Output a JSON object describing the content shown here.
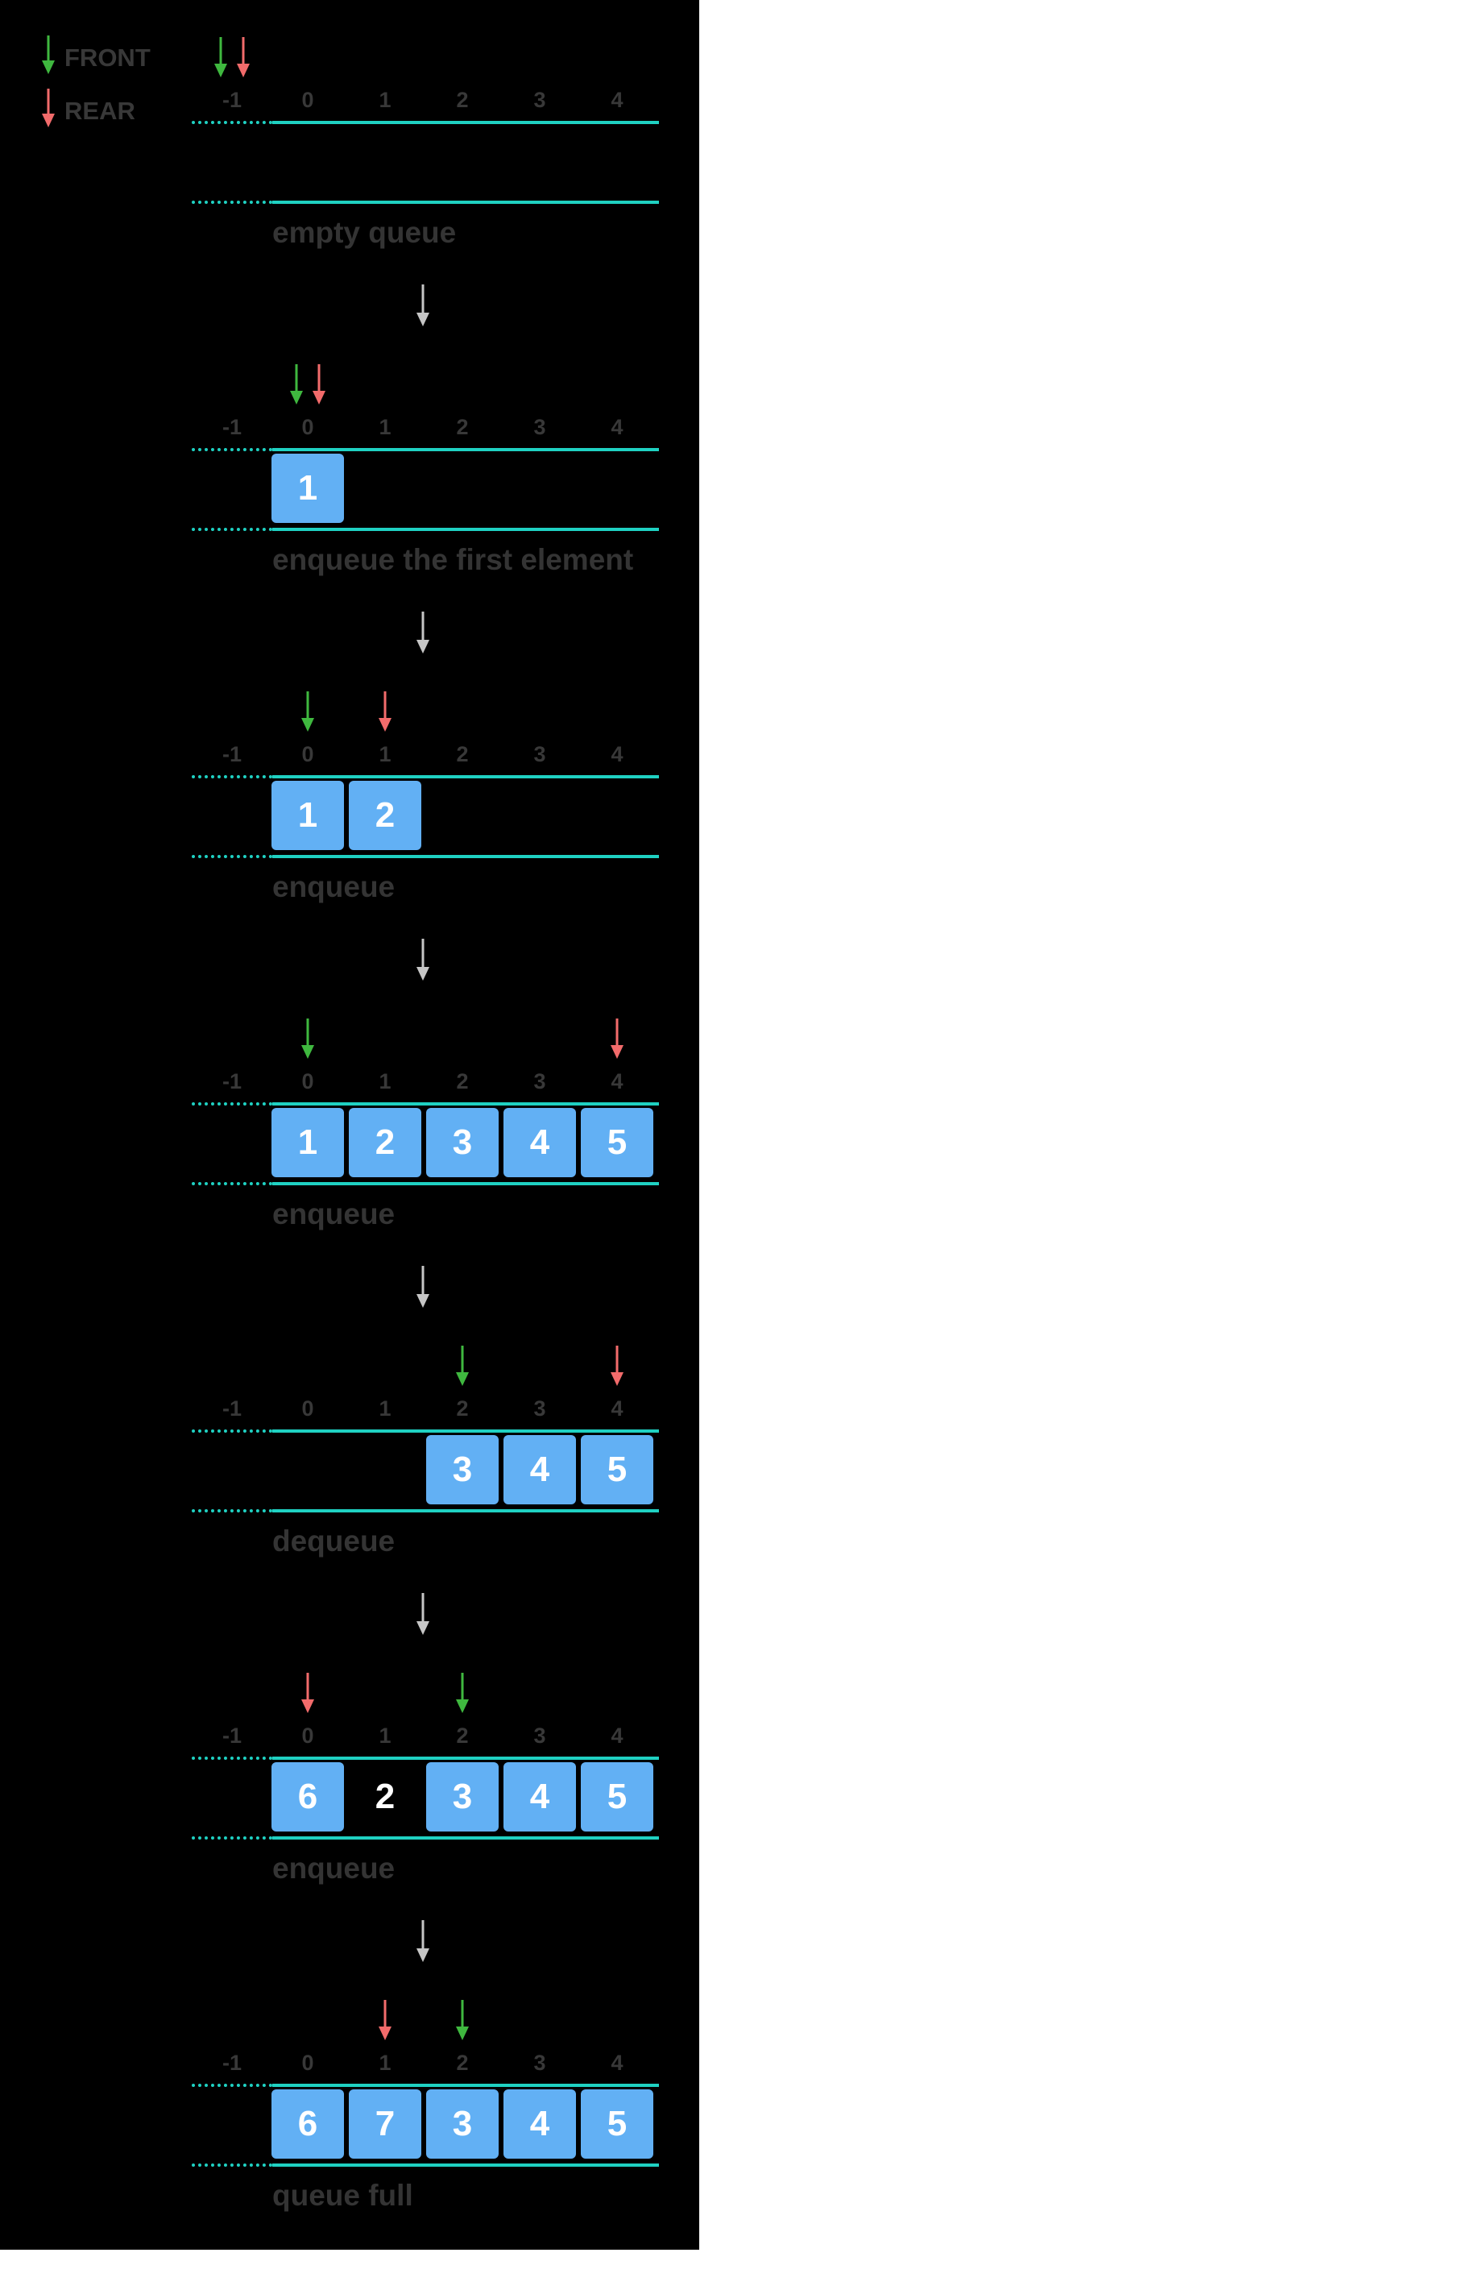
{
  "legend": [
    {
      "label": "FRONT",
      "color": "#3fb83f"
    },
    {
      "label": "REAR",
      "color": "#f26b6b"
    }
  ],
  "colors": {
    "background": "#000000",
    "rail": "#1fd1c2",
    "cell_fill": "#62b0f4",
    "cell_text": "#ffffff",
    "index_text": "#383838",
    "caption_text": "#343434",
    "flow_arrow": "#c6c6c6",
    "front_arrow": "#3fb83f",
    "rear_arrow": "#f26b6b",
    "stale_text": "#ffffff"
  },
  "indices": [
    "-1",
    "0",
    "1",
    "2",
    "3",
    "4"
  ],
  "steps": [
    {
      "caption": "empty queue",
      "front": "-1",
      "rear": "-1",
      "cells": [
        null,
        null,
        null,
        null,
        null
      ],
      "stale": []
    },
    {
      "caption": "enqueue the first element",
      "front": "0",
      "rear": "0",
      "cells": [
        "1",
        null,
        null,
        null,
        null
      ],
      "stale": []
    },
    {
      "caption": "enqueue",
      "front": "0",
      "rear": "1",
      "cells": [
        "1",
        "2",
        null,
        null,
        null
      ],
      "stale": []
    },
    {
      "caption": "enqueue",
      "front": "0",
      "rear": "4",
      "cells": [
        "1",
        "2",
        "3",
        "4",
        "5"
      ],
      "stale": []
    },
    {
      "caption": "dequeue",
      "front": "2",
      "rear": "4",
      "cells": [
        null,
        null,
        "3",
        "4",
        "5"
      ],
      "stale": []
    },
    {
      "caption": "enqueue",
      "front": "2",
      "rear": "0",
      "cells": [
        "6",
        null,
        "3",
        "4",
        "5"
      ],
      "stale": [
        {
          "slot": "1",
          "text": "2"
        }
      ]
    },
    {
      "caption": "queue full",
      "front": "2",
      "rear": "1",
      "cells": [
        "6",
        "7",
        "3",
        "4",
        "5"
      ],
      "stale": []
    }
  ]
}
